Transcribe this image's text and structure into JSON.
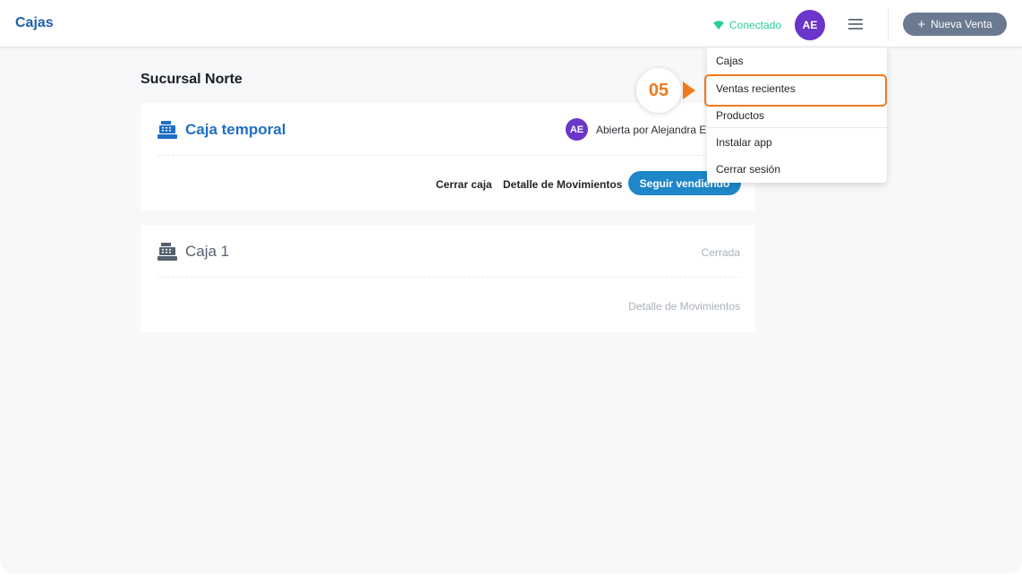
{
  "header": {
    "title": "Cajas",
    "connection_status": "Conectado",
    "user_initials": "AE",
    "new_sale_label": "Nueva Venta",
    "new_sale_icon": "plus-icon",
    "menu_icon": "hamburger-menu-icon",
    "connection_icon": "wifi-icon"
  },
  "main": {
    "branch_title": "Sucursal Norte",
    "registers": [
      {
        "name": "Caja temporal",
        "icon": "cash-register-icon",
        "opened_by_initials": "AE",
        "status_text": "Abierta por Alejandra Er",
        "actions": {
          "close": "Cerrar caja",
          "details": "Detalle de Movimientos",
          "continue": "Seguir vendiendo"
        }
      },
      {
        "name": "Caja 1",
        "icon": "cash-register-icon",
        "status_text": "Cerrada",
        "actions": {
          "details": "Detalle de Movimientos"
        }
      }
    ]
  },
  "dropdown": {
    "items": [
      {
        "label": "Cajas"
      },
      {
        "label": "Ventas recientes"
      },
      {
        "label": "Productos"
      },
      {
        "label": "Instalar app"
      },
      {
        "label": "Cerrar sesión"
      }
    ]
  },
  "callout": {
    "step": "05",
    "highlight_color": "#ef7a1e"
  },
  "colors": {
    "brand_blue": "#1f5fa8",
    "accent_blue": "#1f86c8",
    "avatar_purple": "#6a35c8",
    "connected_green": "#2ecc9a",
    "new_sale_gray": "#6b7a90"
  }
}
